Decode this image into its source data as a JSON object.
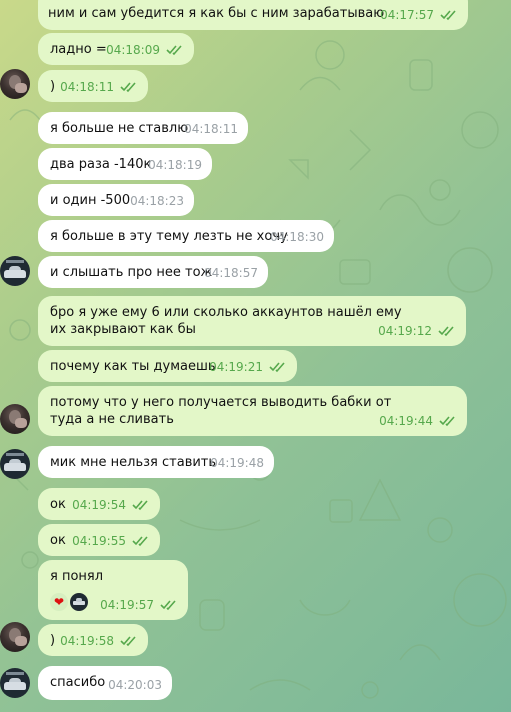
{
  "chat": {
    "messages": [
      {
        "text": "ним и сам убедится я как бы с ним зарабатываю",
        "time": "04:17:57",
        "dir": "out"
      },
      {
        "text": "ладно =",
        "time": "04:18:09",
        "dir": "out"
      },
      {
        "text": ")",
        "time": "04:18:11",
        "dir": "in"
      },
      {
        "text": "я больше не ставлю",
        "time": "04:18:11",
        "dir": "in"
      },
      {
        "text": "два раза -140к",
        "time": "04:18:19",
        "dir": "in"
      },
      {
        "text": "и один -500",
        "time": "04:18:23",
        "dir": "in"
      },
      {
        "text": "я больше в эту тему лезть не хочу",
        "time": "04:18:30",
        "dir": "in"
      },
      {
        "text": "и слышать про нее тож",
        "time": "04:18:57",
        "dir": "in"
      },
      {
        "text": "бро я уже ему 6 или сколько аккаунтов нашёл ему их закрывают как бы",
        "time": "04:19:12",
        "dir": "out"
      },
      {
        "text": "почему как ты думаешь",
        "time": "04:19:21",
        "dir": "out"
      },
      {
        "text": "потому что у него получается выводить бабки от туда а не сливать",
        "time": "04:19:44",
        "dir": "out"
      },
      {
        "text": "мик мне нельзя ставить",
        "time": "04:19:48",
        "dir": "in"
      },
      {
        "text": "ок",
        "time": "04:19:54",
        "dir": "out"
      },
      {
        "text": "ок",
        "time": "04:19:55",
        "dir": "out"
      },
      {
        "text": "я понял",
        "time": "04:19:57",
        "dir": "out",
        "reactions": [
          "heart",
          "avatar"
        ]
      },
      {
        "text": ")",
        "time": "04:19:58",
        "dir": "out"
      },
      {
        "text": "спасибо",
        "time": "04:20:03",
        "dir": "in"
      }
    ]
  },
  "colors": {
    "incoming_bubble": "#ffffff",
    "outgoing_bubble": "#e3f7c8",
    "read_check": "#56a84c",
    "time_in": "#9aa1a6"
  },
  "icons": {
    "read": "double-check-icon",
    "heart": "heart-icon"
  }
}
